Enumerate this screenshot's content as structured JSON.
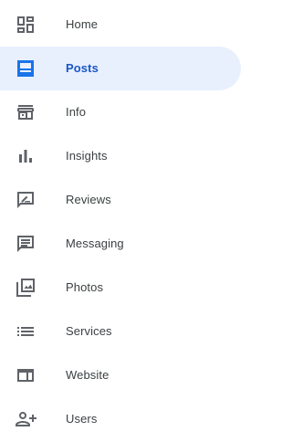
{
  "nav": {
    "active_color": "#1a73e8",
    "active_background": "#e8f0fe",
    "items": [
      {
        "label": "Home",
        "icon": "dashboard-icon",
        "active": false
      },
      {
        "label": "Posts",
        "icon": "posts-icon",
        "active": true
      },
      {
        "label": "Info",
        "icon": "storefront-icon",
        "active": false
      },
      {
        "label": "Insights",
        "icon": "bar-chart-icon",
        "active": false
      },
      {
        "label": "Reviews",
        "icon": "rate-review-icon",
        "active": false
      },
      {
        "label": "Messaging",
        "icon": "message-icon",
        "active": false
      },
      {
        "label": "Photos",
        "icon": "photo-library-icon",
        "active": false
      },
      {
        "label": "Services",
        "icon": "list-icon",
        "active": false
      },
      {
        "label": "Website",
        "icon": "web-icon",
        "active": false
      },
      {
        "label": "Users",
        "icon": "person-add-icon",
        "active": false
      }
    ]
  }
}
